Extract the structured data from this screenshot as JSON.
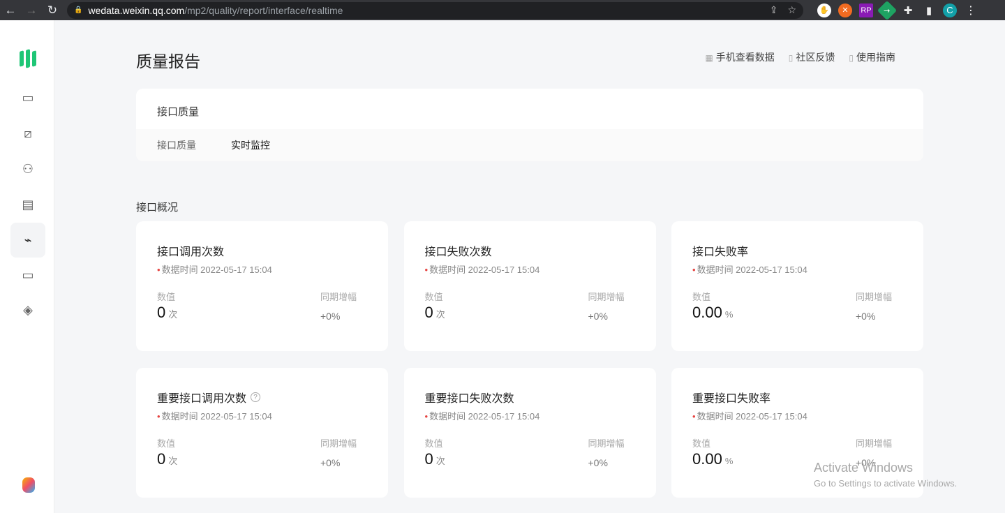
{
  "browser": {
    "url_host": "wedata.weixin.qq.com",
    "url_path": "/mp2/quality/report/interface/realtime",
    "profile_initial": "C"
  },
  "sidebar": {
    "items": [
      "monitor-icon",
      "chart-icon",
      "users-icon",
      "clipboard-icon",
      "realtime-monitor-icon",
      "folder-icon",
      "layers-icon"
    ],
    "active": 4
  },
  "header": {
    "title": "质量报告",
    "links": [
      "手机查看数据",
      "社区反馈",
      "使用指南"
    ]
  },
  "panel": {
    "title": "接口质量",
    "tabs": [
      "接口质量",
      "实时监控"
    ]
  },
  "section_title": "接口概况",
  "labels": {
    "value": "数值",
    "yoy": "同期增幅",
    "data_time_prefix": "数据时间"
  },
  "cards": [
    {
      "title": "接口调用次数",
      "time": "数据时间 2022-05-17 15:04",
      "value": "0",
      "unit": "次",
      "yoy": "+0%"
    },
    {
      "title": "接口失败次数",
      "time": "数据时间 2022-05-17 15:04",
      "value": "0",
      "unit": "次",
      "yoy": "+0%"
    },
    {
      "title": "接口失败率",
      "time": "数据时间 2022-05-17 15:04",
      "value": "0.00",
      "unit": "%",
      "yoy": "+0%"
    },
    {
      "title": "重要接口调用次数",
      "time": "数据时间 2022-05-17 15:04",
      "value": "0",
      "unit": "次",
      "yoy": "+0%"
    },
    {
      "title": "重要接口失败次数",
      "time": "数据时间 2022-05-17 15:04",
      "value": "0",
      "unit": "次",
      "yoy": "+0%"
    },
    {
      "title": "重要接口失败率",
      "time": "数据时间 2022-05-17 15:04",
      "value": "0.00",
      "unit": "%",
      "yoy": "+0%"
    }
  ],
  "watermark": {
    "line1": "Activate Windows",
    "line2": "Go to Settings to activate Windows."
  },
  "colors": {
    "brand": "#1fc676",
    "alert_dot": "#e64340"
  }
}
